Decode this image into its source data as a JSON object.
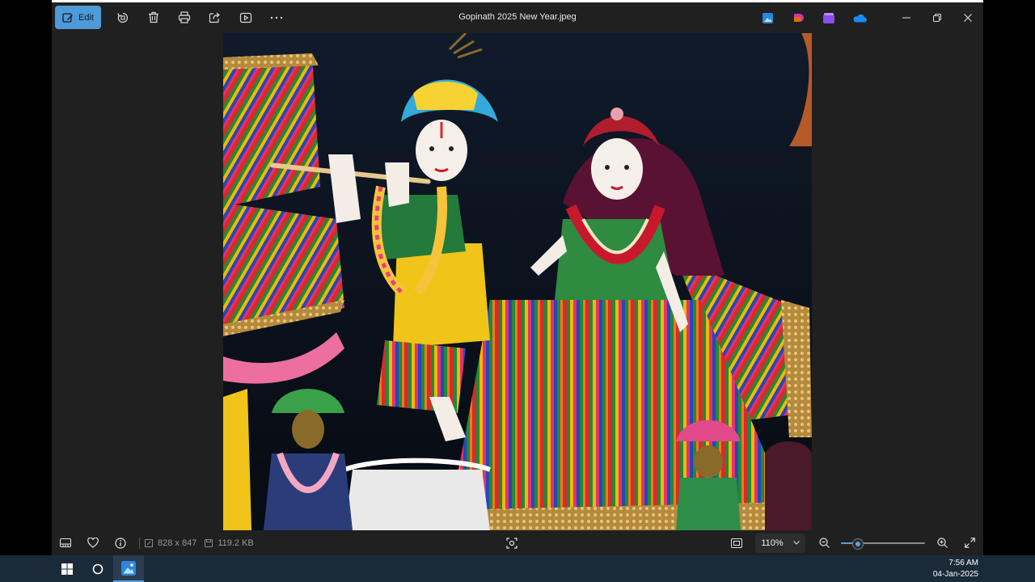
{
  "window": {
    "title": "Gopinath 2025 New Year.jpeg"
  },
  "toolbar": {
    "edit_label": "Edit",
    "icons": [
      "edit-image-icon",
      "rotate-icon",
      "delete-icon",
      "print-icon",
      "share-icon",
      "slideshow-icon",
      "more-icon"
    ]
  },
  "titlebar_apps": [
    "photos-app-icon",
    "designer-app-icon",
    "clipchamp-app-icon",
    "onedrive-cloud-icon"
  ],
  "image": {
    "description_icon": "photo"
  },
  "statusbar": {
    "dimensions": "828 x 847",
    "file_size": "119.2 KB",
    "zoom_value": "110%",
    "zoom_level": 0.19
  },
  "taskbar": {
    "time": "7:56 AM",
    "date": "04-Jan-2025"
  },
  "colors": {
    "accent": "#4f9ad8",
    "window_bg": "#202020",
    "taskbar_bg": "#1b2a39"
  }
}
